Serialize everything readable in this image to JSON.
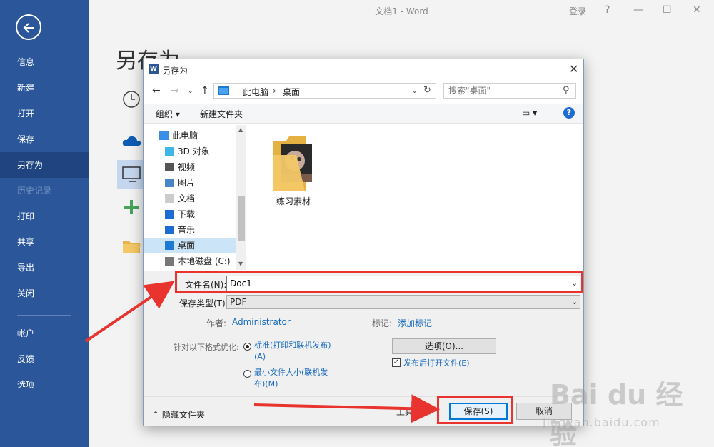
{
  "window": {
    "title": "文档1 - Word",
    "login": "登录",
    "help": "?",
    "minimize": "—",
    "maximize": "☐",
    "close": "✕"
  },
  "backstage": {
    "items": [
      {
        "label": "信息"
      },
      {
        "label": "新建"
      },
      {
        "label": "打开"
      },
      {
        "label": "保存"
      },
      {
        "label": "另存为",
        "active": true
      },
      {
        "label": "历史记录",
        "disabled": true
      },
      {
        "label": "打印"
      },
      {
        "label": "共享"
      },
      {
        "label": "导出"
      },
      {
        "label": "关闭"
      },
      {
        "label": "帐户"
      },
      {
        "label": "反馈"
      },
      {
        "label": "选项"
      }
    ],
    "page_title": "另存为"
  },
  "dialog": {
    "title": "另存为",
    "close": "✕",
    "address": {
      "crumb1": "此电脑",
      "separator": "›",
      "crumb2": "桌面"
    },
    "search_placeholder": "搜索\"桌面\"",
    "toolbar": {
      "organize": "组织 ▾",
      "new_folder": "新建文件夹",
      "view": "▭ ▾",
      "help": "?"
    },
    "tree": [
      {
        "label": "此电脑",
        "icon": "pc-icon",
        "root": true
      },
      {
        "label": "3D 对象",
        "icon": "cube-icon"
      },
      {
        "label": "视频",
        "icon": "video-icon"
      },
      {
        "label": "图片",
        "icon": "picture-icon"
      },
      {
        "label": "文档",
        "icon": "document-icon"
      },
      {
        "label": "下载",
        "icon": "download-icon"
      },
      {
        "label": "音乐",
        "icon": "music-icon"
      },
      {
        "label": "桌面",
        "icon": "desktop-icon",
        "selected": true
      },
      {
        "label": "本地磁盘 (C:)",
        "icon": "disk-icon"
      }
    ],
    "files": [
      {
        "label": "练习素材"
      }
    ],
    "form": {
      "filename_label": "文件名(N):",
      "filename_value": "Doc1",
      "filetype_label": "保存类型(T):",
      "filetype_value": "PDF",
      "author_label": "作者:",
      "author_value": "Administrator",
      "tags_label": "标记:",
      "tags_value": "添加标记",
      "optimize_label": "针对以下格式优化:",
      "opt_standard": "标准(打印和联机发布)",
      "opt_standard_key": "(A)",
      "opt_min": "最小文件大小(联机发",
      "opt_min_2": "布)(M)",
      "options_button": "选项(O)...",
      "open_after": "发布后打开文件(E)"
    },
    "bottom": {
      "hide_folders": "隐藏文件夹",
      "tools": "工具(L) ▾",
      "save": "保存(S)",
      "cancel": "取消"
    }
  },
  "watermark": {
    "logo": "Bai du 经验",
    "url": "jingyan.baidu.com"
  },
  "colors": {
    "word_blue": "#2b579a",
    "annotation_red": "#e8332e",
    "link_blue": "#1a6bbf"
  }
}
